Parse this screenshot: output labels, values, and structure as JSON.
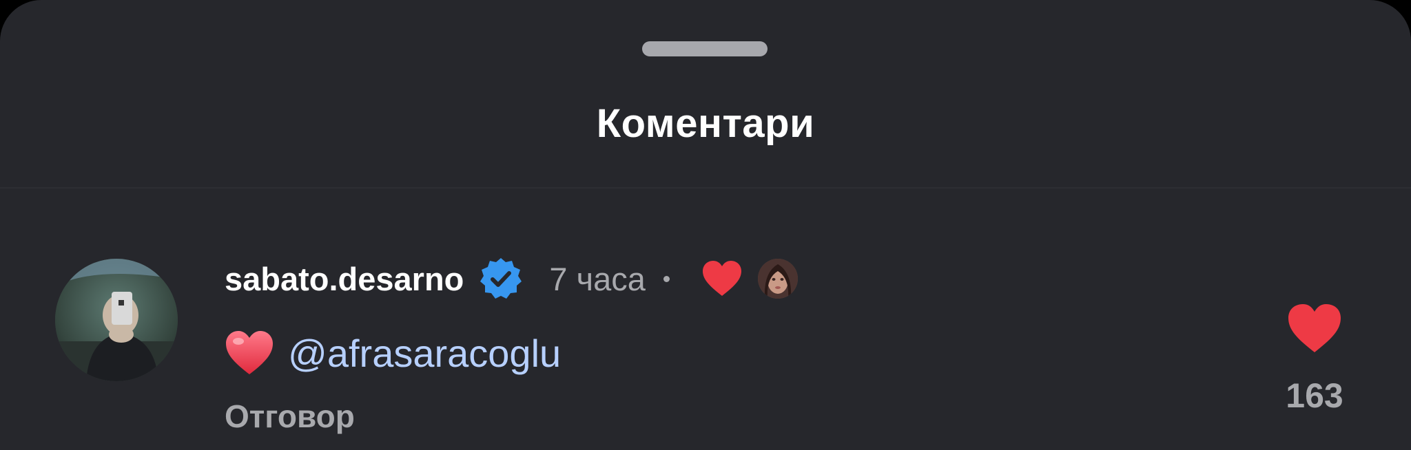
{
  "sheet": {
    "title": "Коментари"
  },
  "comment": {
    "username": "sabato.desarno",
    "verified": true,
    "time": "7 часа",
    "author_liked": true,
    "text_emoji": "heart-emoji",
    "mention": "@afrasaracoglu",
    "reply_label": "Отговор",
    "like_count": "163"
  },
  "icons": {
    "verified": "verified-badge-icon",
    "like": "heart-icon"
  },
  "colors": {
    "background": "#26272c",
    "like_red": "#ee3a45",
    "verified_blue": "#3797f0",
    "mention": "#b7d0ff",
    "secondary_text": "#a8a9ad"
  }
}
